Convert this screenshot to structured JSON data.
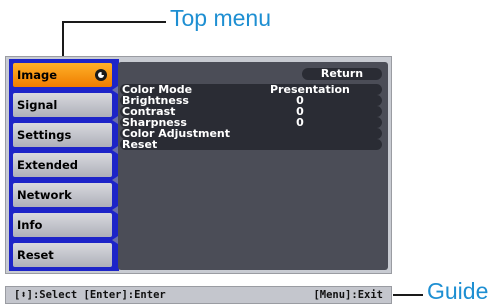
{
  "callouts": {
    "top_menu": "Top menu",
    "guide": "Guide"
  },
  "menu": {
    "items": [
      {
        "label": "Image",
        "active": true
      },
      {
        "label": "Signal",
        "active": false
      },
      {
        "label": "Settings",
        "active": false
      },
      {
        "label": "Extended",
        "active": false
      },
      {
        "label": "Network",
        "active": false
      },
      {
        "label": "Info",
        "active": false
      },
      {
        "label": "Reset",
        "active": false
      }
    ]
  },
  "submenu": {
    "return_label": "Return",
    "rows": [
      {
        "label": "Color Mode",
        "value": "Presentation"
      },
      {
        "label": "Brightness",
        "value": "0"
      },
      {
        "label": "Contrast",
        "value": "0"
      },
      {
        "label": "Sharpness",
        "value": "0"
      },
      {
        "label": "Color Adjustment",
        "value": ""
      },
      {
        "label": "Reset",
        "value": ""
      }
    ]
  },
  "guide": {
    "left_text": "[⬍]:Select [Enter]:Enter",
    "right_text": "[Menu]:Exit"
  },
  "colors": {
    "accent_callout": "#1e8fd2",
    "active_item": "#f08a00",
    "menu_border": "#1d24c8"
  }
}
